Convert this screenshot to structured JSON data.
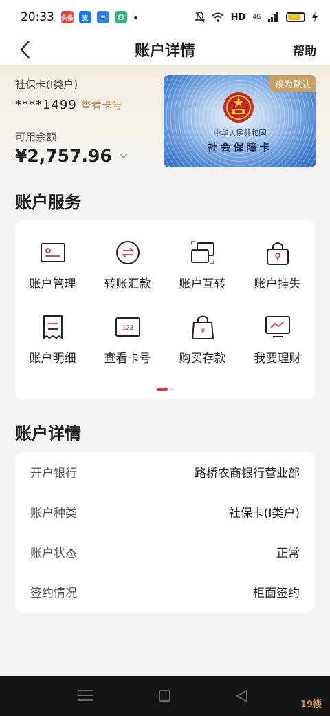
{
  "status_bar": {
    "time": "20:33",
    "app_icons": [
      {
        "name": "toutiao-icon",
        "label": "头条",
        "color": "#e64340"
      },
      {
        "name": "alipay-icon",
        "label": "支",
        "color": "#1677ff"
      },
      {
        "name": "infinity-app-icon",
        "label": "∞",
        "color": "#2f7ff0"
      },
      {
        "name": "green-app-icon",
        "label": "",
        "color": "#33b57a"
      }
    ],
    "network": "HD",
    "signal": "4G"
  },
  "nav": {
    "title": "账户详情",
    "help_label": "帮助"
  },
  "account": {
    "type": "社保卡(I类户)",
    "card_number": "****1499",
    "view_number_label": "查看卡号",
    "balance_label": "可用余额",
    "balance": "¥2,757.96",
    "card_image": {
      "default_tag": "设为默认",
      "line1": "中华人民共和国",
      "line2": "社会保障卡"
    }
  },
  "services": {
    "section_title": "账户服务",
    "items": [
      {
        "label": "账户管理",
        "icon": "account-card-icon"
      },
      {
        "label": "转账汇款",
        "icon": "transfer-icon"
      },
      {
        "label": "账户互转",
        "icon": "mutual-transfer-icon"
      },
      {
        "label": "账户挂失",
        "icon": "lock-bag-icon"
      },
      {
        "label": "账户明细",
        "icon": "receipt-icon"
      },
      {
        "label": "查看卡号",
        "icon": "card-number-icon"
      },
      {
        "label": "购买存款",
        "icon": "deposit-bag-icon"
      },
      {
        "label": "我要理财",
        "icon": "chart-monitor-icon"
      }
    ],
    "card_number_icon_text": "123",
    "deposit_icon_text": "¥",
    "page_indicator": {
      "current": 1,
      "total": 2
    }
  },
  "details": {
    "section_title": "账户详情",
    "rows": [
      {
        "label": "开户银行",
        "value": "路桥农商银行营业部"
      },
      {
        "label": "账户种类",
        "value": "社保卡(I类户)"
      },
      {
        "label": "账户状态",
        "value": "正常"
      },
      {
        "label": "签约情况",
        "value": "柜面签约"
      }
    ]
  },
  "watermark": "19楼",
  "colors": {
    "accent_red": "#d03a3a",
    "gold": "#b48a4e",
    "tag_gold": "#c9a26b"
  }
}
